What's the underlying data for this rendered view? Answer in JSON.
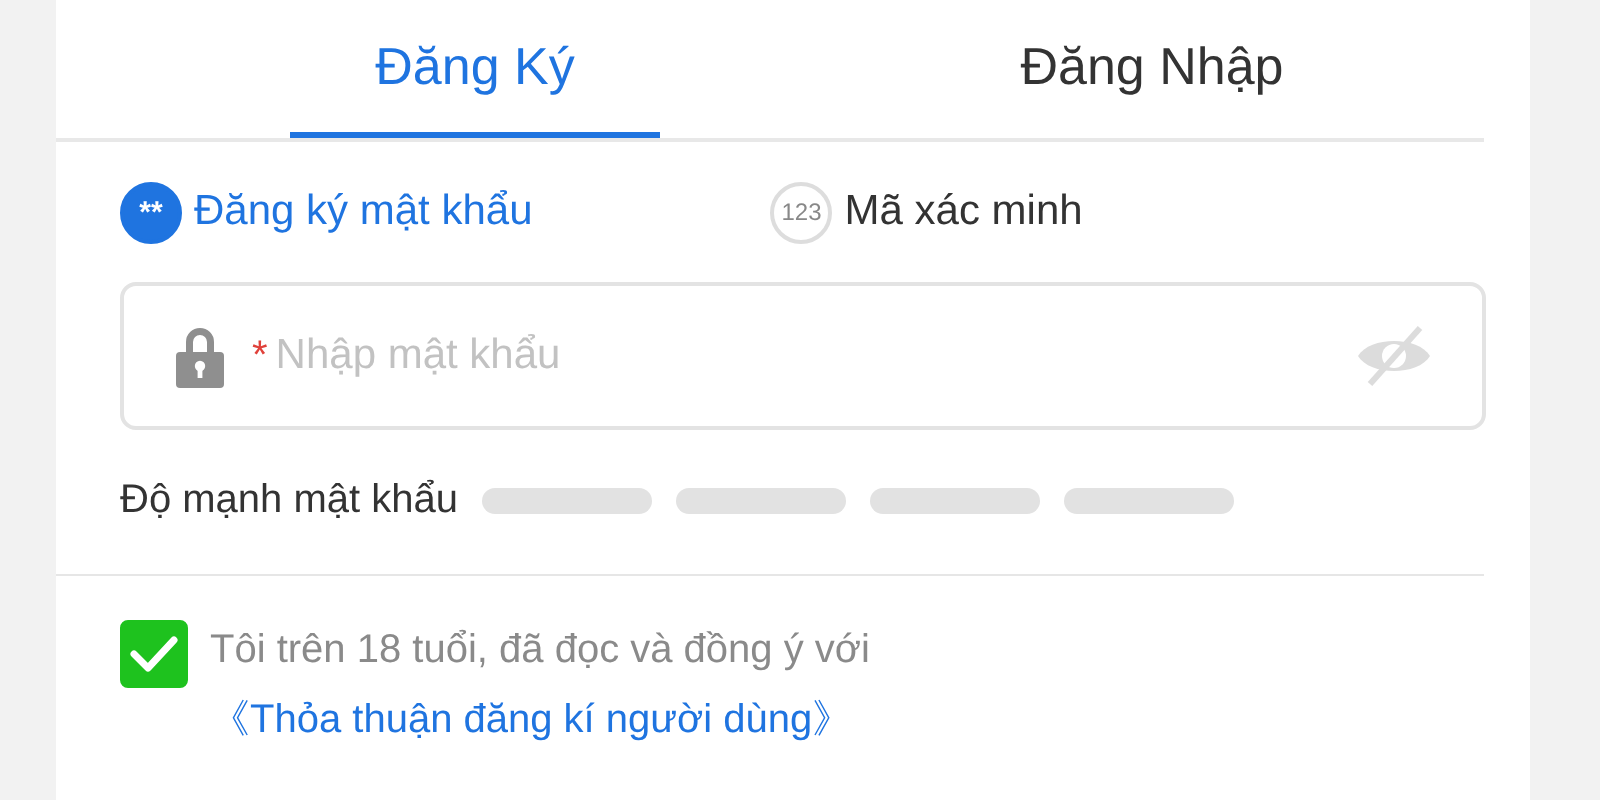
{
  "tabs": [
    {
      "label": "Đăng Ký",
      "selected": true
    },
    {
      "label": "Đăng Nhập",
      "selected": false
    }
  ],
  "methods": [
    {
      "icon": "**",
      "label": "Đăng ký mật khẩu",
      "selected": true
    },
    {
      "icon": "123",
      "label": "Mã xác minh",
      "selected": false
    }
  ],
  "password_field": {
    "required_mark": "*",
    "placeholder": "Nhập mật khẩu"
  },
  "strength": {
    "label": "Độ mạnh mật khẩu"
  },
  "agreement": {
    "checked": true,
    "text": "Tôi trên 18 tuổi, đã đọc và đồng ý với",
    "link": "《Thỏa thuận đăng kí người dùng》"
  }
}
